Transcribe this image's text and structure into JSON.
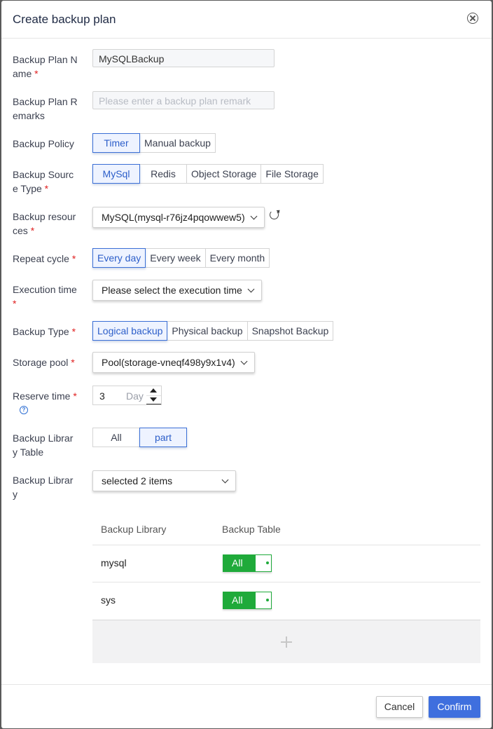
{
  "dialog": {
    "title": "Create backup plan"
  },
  "form": {
    "plan_name": {
      "label": "Backup Plan N",
      "label2": "ame",
      "value": "MySQLBackup"
    },
    "remarks": {
      "label": "Backup Plan R",
      "label2": "emarks",
      "placeholder": "Please enter a backup plan remark"
    },
    "policy": {
      "label": "Backup Policy",
      "options": [
        "Timer",
        "Manual backup"
      ],
      "selected": "Timer"
    },
    "source_type": {
      "label": "Backup Sourc",
      "label2": "e Type",
      "options": [
        "MySql",
        "Redis",
        "Object Storage",
        "File Storage"
      ],
      "selected": "MySql"
    },
    "resources": {
      "label": "Backup resour",
      "label2": "ces",
      "value": "MySQL(mysql-r76jz4pqowwew5)"
    },
    "repeat": {
      "label": "Repeat cycle",
      "options": [
        "Every day",
        "Every week",
        "Every month"
      ],
      "selected": "Every day"
    },
    "exec_time": {
      "label": "Execution time",
      "value": "Please select the execution time"
    },
    "backup_type": {
      "label": "Backup Type",
      "options": [
        "Logical backup",
        "Physical backup",
        "Snapshot Backup"
      ],
      "selected": "Logical backup"
    },
    "storage_pool": {
      "label": "Storage pool",
      "value": "Pool(storage-vneqf498y9x1v4)"
    },
    "reserve": {
      "label": "Reserve time",
      "value": "3",
      "unit": "Day"
    },
    "library_table": {
      "label": "Backup Librar",
      "label2": "y Table",
      "options": [
        "All",
        "part"
      ],
      "selected": "part"
    },
    "library": {
      "label": "Backup Librar",
      "label2": "y",
      "value": "selected 2 items"
    },
    "required_mark": "*",
    "help_glyph": "?"
  },
  "table": {
    "headers": [
      "Backup Library",
      "Backup Table"
    ],
    "rows": [
      {
        "library": "mysql",
        "toggle": "All"
      },
      {
        "library": "sys",
        "toggle": "All"
      }
    ]
  },
  "footer": {
    "cancel": "Cancel",
    "confirm": "Confirm"
  },
  "colors": {
    "accent": "#3f6fde",
    "toggle_green": "#1faa3a",
    "required": "#e02020"
  }
}
